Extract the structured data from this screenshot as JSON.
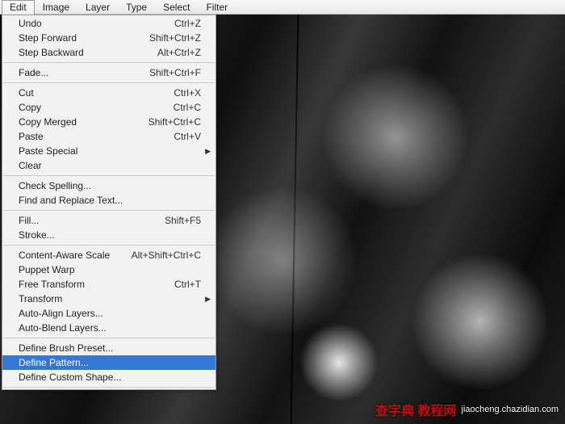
{
  "menubar": {
    "items": [
      "Edit",
      "Image",
      "Layer",
      "Type",
      "Select",
      "Filter"
    ],
    "active_index": 0
  },
  "dropdown": {
    "sections": [
      [
        {
          "label": "Undo",
          "shortcut": "Ctrl+Z",
          "submenu": false
        },
        {
          "label": "Step Forward",
          "shortcut": "Shift+Ctrl+Z",
          "submenu": false
        },
        {
          "label": "Step Backward",
          "shortcut": "Alt+Ctrl+Z",
          "submenu": false
        }
      ],
      [
        {
          "label": "Fade...",
          "shortcut": "Shift+Ctrl+F",
          "submenu": false
        }
      ],
      [
        {
          "label": "Cut",
          "shortcut": "Ctrl+X",
          "submenu": false
        },
        {
          "label": "Copy",
          "shortcut": "Ctrl+C",
          "submenu": false
        },
        {
          "label": "Copy Merged",
          "shortcut": "Shift+Ctrl+C",
          "submenu": false
        },
        {
          "label": "Paste",
          "shortcut": "Ctrl+V",
          "submenu": false
        },
        {
          "label": "Paste Special",
          "shortcut": "",
          "submenu": true
        },
        {
          "label": "Clear",
          "shortcut": "",
          "submenu": false
        }
      ],
      [
        {
          "label": "Check Spelling...",
          "shortcut": "",
          "submenu": false
        },
        {
          "label": "Find and Replace Text...",
          "shortcut": "",
          "submenu": false
        }
      ],
      [
        {
          "label": "Fill...",
          "shortcut": "Shift+F5",
          "submenu": false
        },
        {
          "label": "Stroke...",
          "shortcut": "",
          "submenu": false
        }
      ],
      [
        {
          "label": "Content-Aware Scale",
          "shortcut": "Alt+Shift+Ctrl+C",
          "submenu": false
        },
        {
          "label": "Puppet Warp",
          "shortcut": "",
          "submenu": false
        },
        {
          "label": "Free Transform",
          "shortcut": "Ctrl+T",
          "submenu": false
        },
        {
          "label": "Transform",
          "shortcut": "",
          "submenu": true
        },
        {
          "label": "Auto-Align Layers...",
          "shortcut": "",
          "submenu": false
        },
        {
          "label": "Auto-Blend Layers...",
          "shortcut": "",
          "submenu": false
        }
      ],
      [
        {
          "label": "Define Brush Preset...",
          "shortcut": "",
          "submenu": false
        },
        {
          "label": "Define Pattern...",
          "shortcut": "",
          "submenu": false,
          "highlighted": true
        },
        {
          "label": "Define Custom Shape...",
          "shortcut": "",
          "submenu": false
        }
      ]
    ]
  },
  "watermark": {
    "cn": "查字典 教程网",
    "url": "jiaocheng.chazidian.com"
  }
}
